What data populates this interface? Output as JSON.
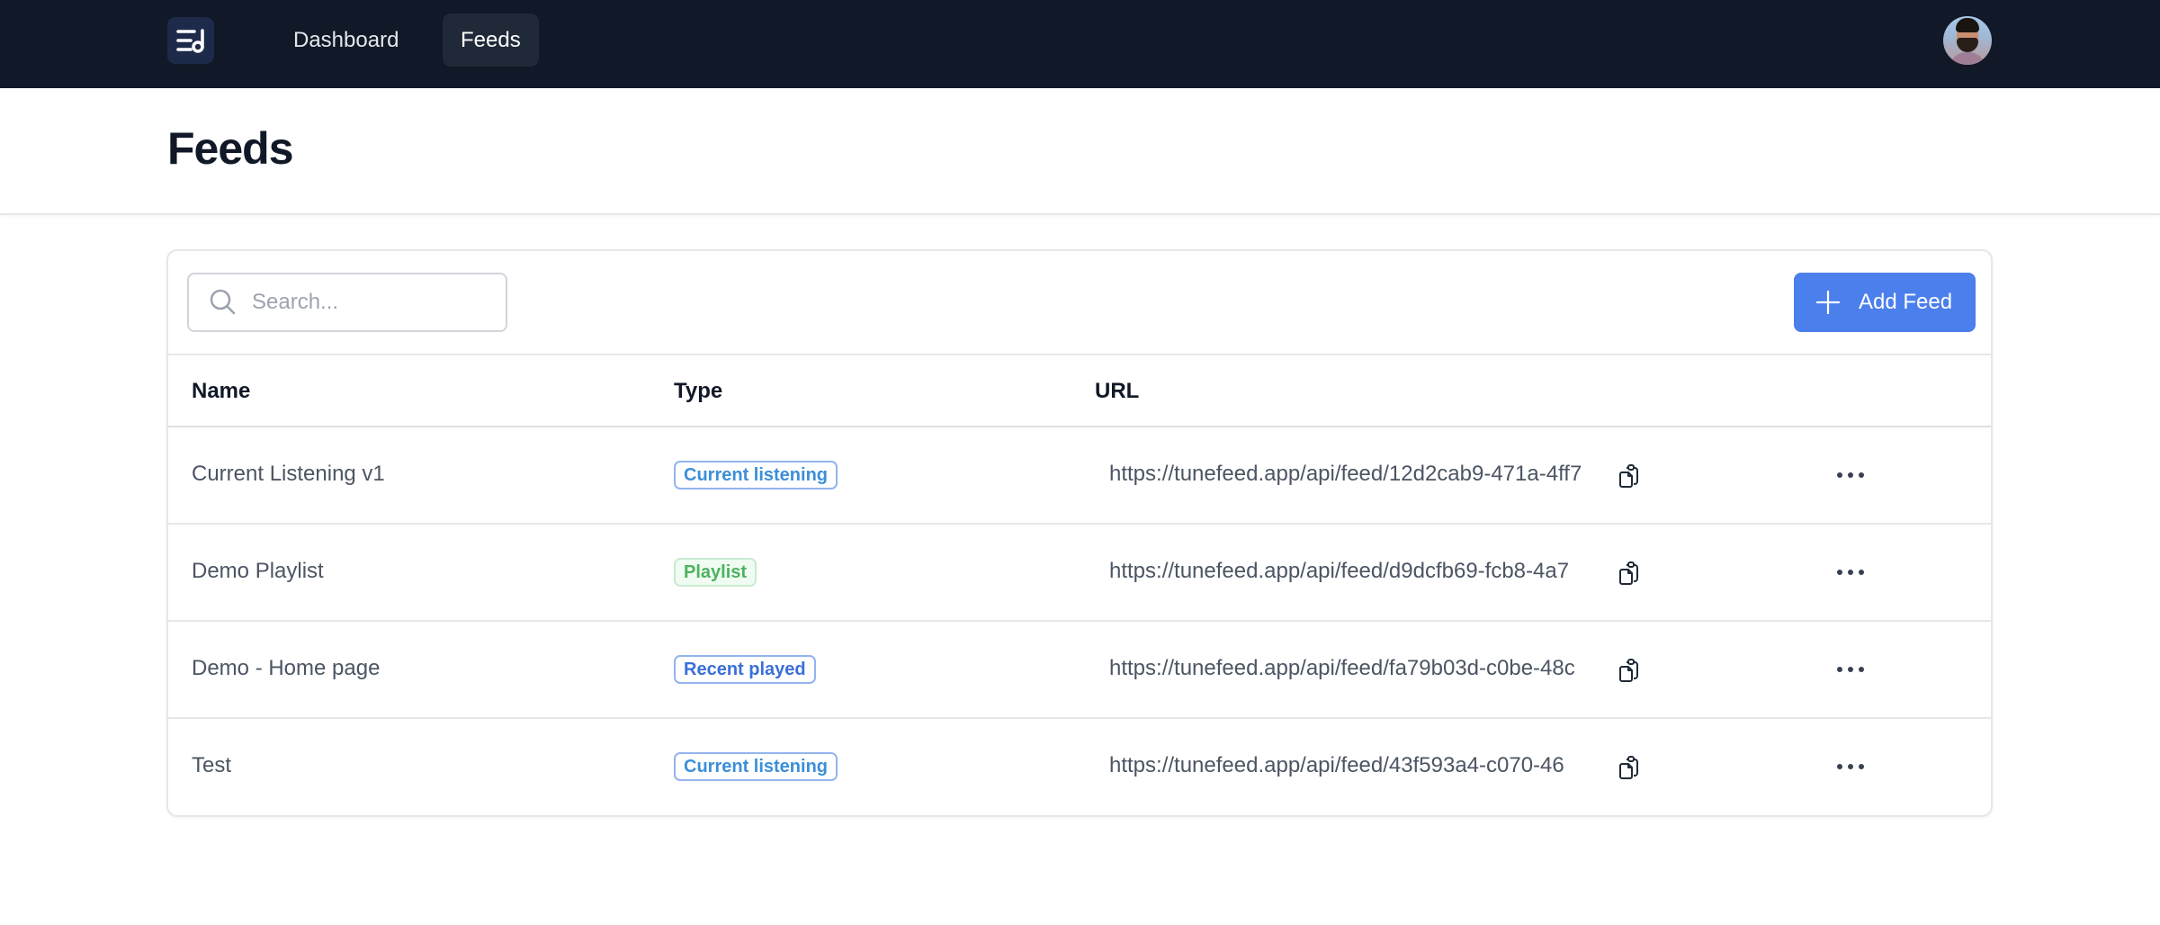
{
  "nav": {
    "logo_icon": "music-list-icon",
    "items": [
      {
        "label": "Dashboard",
        "active": false
      },
      {
        "label": "Feeds",
        "active": true
      }
    ],
    "avatar_icon": "user-avatar"
  },
  "header": {
    "title": "Feeds"
  },
  "toolbar": {
    "search_placeholder": "Search...",
    "search_value": "",
    "add_label": "Add Feed",
    "accent": "#4b7fec"
  },
  "table": {
    "columns": [
      "Name",
      "Type",
      "URL"
    ],
    "rows": [
      {
        "name": "Current Listening v1",
        "type": "Current listening",
        "type_key": "current",
        "url": "https://tunefeed.app/api/feed/12d2cab9-471a-4ff7"
      },
      {
        "name": "Demo Playlist",
        "type": "Playlist",
        "type_key": "playlist",
        "url": "https://tunefeed.app/api/feed/d9dcfb69-fcb8-4a7"
      },
      {
        "name": "Demo - Home page",
        "type": "Recent played",
        "type_key": "recent",
        "url": "https://tunefeed.app/api/feed/fa79b03d-c0be-48c"
      },
      {
        "name": "Test",
        "type": "Current listening",
        "type_key": "current",
        "url": "https://tunefeed.app/api/feed/43f593a4-c070-46"
      }
    ]
  },
  "colors": {
    "topbar": "#111827",
    "badge_current": "#3b8fd9",
    "badge_playlist": "#4cb35e",
    "badge_recent": "#3a6fd8"
  }
}
